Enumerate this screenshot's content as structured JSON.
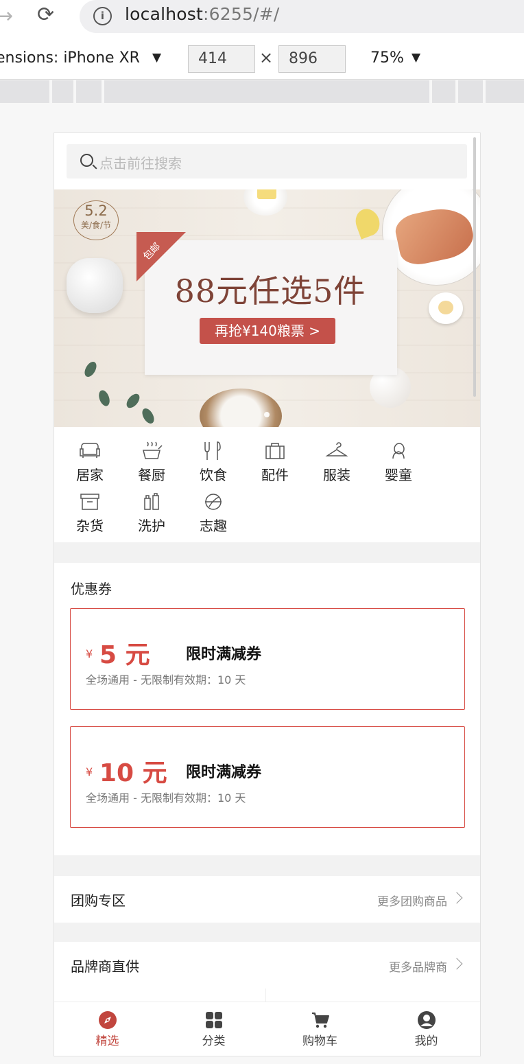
{
  "browser": {
    "url_host": "localhost",
    "url_rest": ":6255/#/"
  },
  "devtools": {
    "dimensions_label": "ensions: iPhone XR",
    "width": "414",
    "height": "896",
    "times": "×",
    "zoom": "75%"
  },
  "search": {
    "placeholder": "点击前往搜索"
  },
  "banner": {
    "badge_number": "5.2",
    "badge_text": "美/食/节",
    "corner_tag": "包邮",
    "headline": "88元任选5件",
    "cta": "再抢¥140粮票 >"
  },
  "categories": [
    {
      "label": "居家",
      "icon": "sofa-icon"
    },
    {
      "label": "餐厨",
      "icon": "pot-icon"
    },
    {
      "label": "饮食",
      "icon": "utensils-icon"
    },
    {
      "label": "配件",
      "icon": "suitcase-icon"
    },
    {
      "label": "服装",
      "icon": "hanger-icon"
    },
    {
      "label": "婴童",
      "icon": "child-icon"
    },
    {
      "label": "杂货",
      "icon": "box-icon"
    },
    {
      "label": "洗护",
      "icon": "bottles-icon"
    },
    {
      "label": "志趣",
      "icon": "globe-icon"
    }
  ],
  "coupons": {
    "title": "优惠券",
    "items": [
      {
        "currency": "¥",
        "amount": "5 元",
        "title": "限时满减券",
        "desc": "全场通用 - 无限制有效期：10 天"
      },
      {
        "currency": "¥",
        "amount": "10 元",
        "title": "限时满减券",
        "desc": "全场通用 - 无限制有效期：10 天"
      }
    ]
  },
  "group_buy": {
    "title": "团购专区",
    "more": "更多团购商品"
  },
  "brands": {
    "title": "品牌商直供",
    "more": "更多品牌商"
  },
  "tabs": [
    {
      "label": "精选",
      "icon": "compass-icon",
      "active": true
    },
    {
      "label": "分类",
      "icon": "grid-icon",
      "active": false
    },
    {
      "label": "购物车",
      "icon": "cart-icon",
      "active": false
    },
    {
      "label": "我的",
      "icon": "user-icon",
      "active": false
    }
  ],
  "colors": {
    "accent": "#c1463e",
    "coupon_border": "#d74b43"
  }
}
